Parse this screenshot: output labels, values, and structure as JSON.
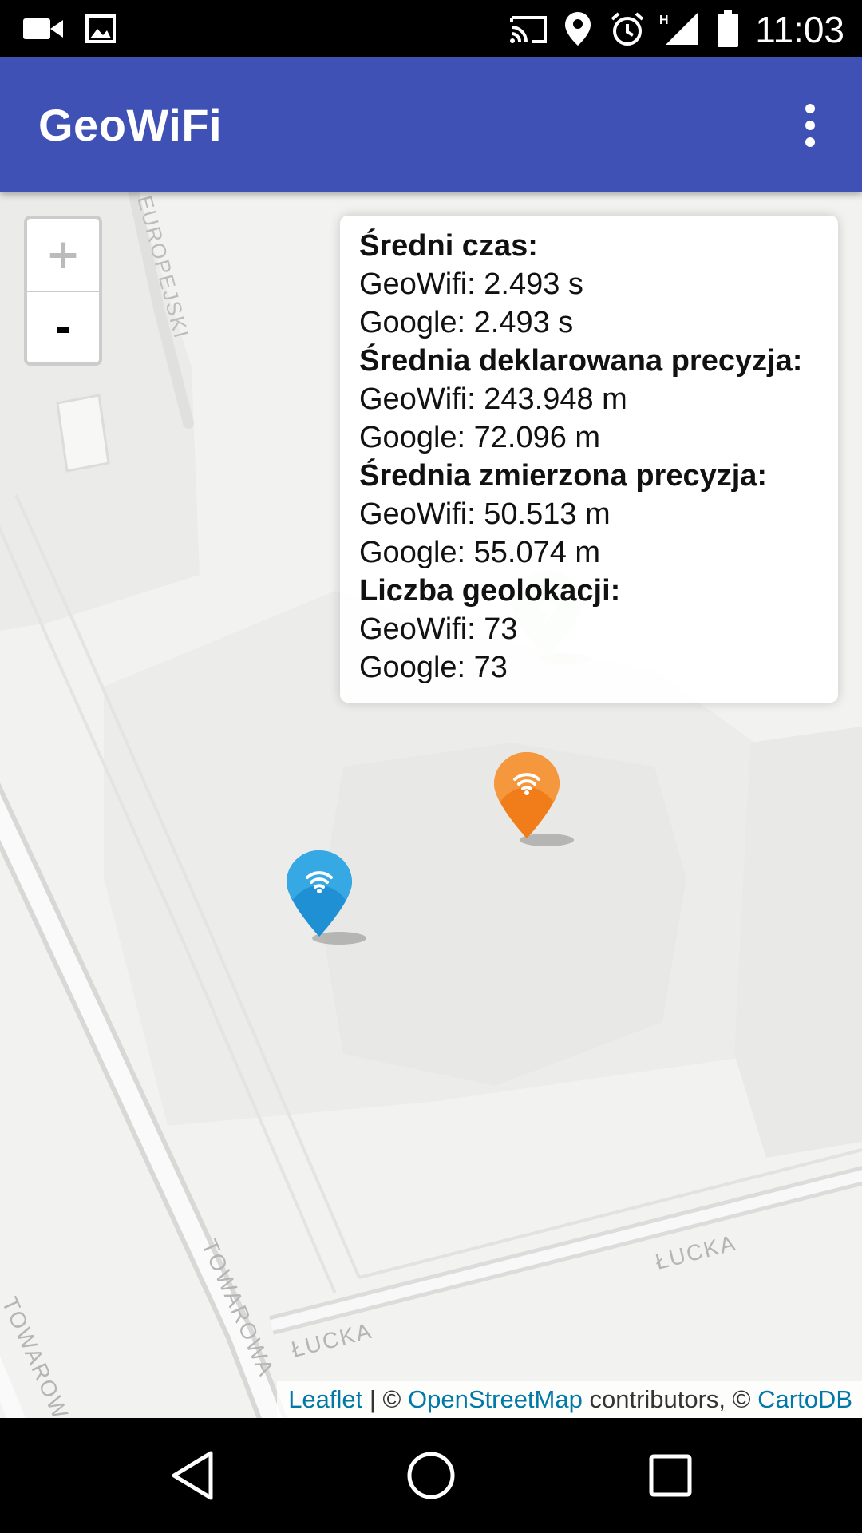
{
  "status_bar": {
    "time": "11:03",
    "icons": [
      "videocam-icon",
      "image-icon",
      "cast-icon",
      "location-icon",
      "alarm-icon",
      "signal-icon",
      "battery-icon"
    ],
    "network_type": "H"
  },
  "app_bar": {
    "title": "GeoWiFi",
    "menu_icon": "more-vert-icon"
  },
  "map": {
    "zoom_in_label": "+",
    "zoom_out_label": "-",
    "street_labels": [
      "EUROPEJSKI",
      "TOWAROWA",
      "TOWAROWA",
      "ŁUCKA",
      "ŁUCKA"
    ],
    "markers": [
      {
        "name": "blue-wifi-marker",
        "color": "#2aa0dc",
        "icon": "wifi-icon"
      },
      {
        "name": "orange-wifi-marker",
        "color": "#f07d1a",
        "icon": "wifi-icon"
      },
      {
        "name": "green-marker",
        "color": "#7cc36f",
        "icon": "bolt-icon"
      }
    ]
  },
  "stats": {
    "avg_time_heading": "Średni czas:",
    "avg_time_geowifi": "GeoWifi: 2.493 s",
    "avg_time_google": "Google: 2.493 s",
    "declared_precision_heading": "Średnia deklarowana precyzja:",
    "declared_precision_geowifi": "GeoWifi: 243.948 m",
    "declared_precision_google": "Google: 72.096 m",
    "measured_precision_heading": "Średnia zmierzona precyzja:",
    "measured_precision_geowifi": "GeoWifi: 50.513 m",
    "measured_precision_google": "Google: 55.074 m",
    "geolocation_count_heading": "Liczba geolokacji:",
    "geolocation_count_geowifi": "GeoWifi: 73",
    "geolocation_count_google": "Google: 73"
  },
  "attribution": {
    "leaflet": "Leaflet",
    "sep1": " | © ",
    "osm": "OpenStreetMap",
    "contributors": " contributors, © ",
    "carto": "CartoDB"
  },
  "nav_bar": {
    "icons": [
      "back-icon",
      "home-icon",
      "recents-icon"
    ]
  }
}
